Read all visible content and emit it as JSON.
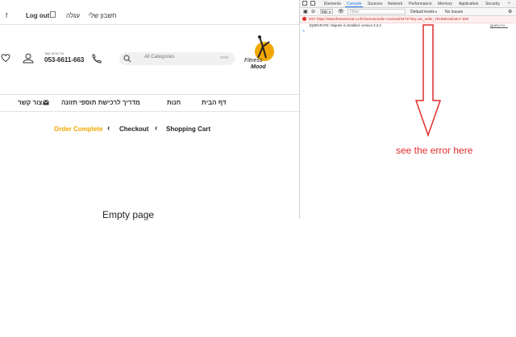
{
  "site": {
    "topbar": {
      "fb": "f",
      "logout": "Log out",
      "cart": "עגלה",
      "account": "חשבון שלי"
    },
    "header": {
      "phone_caption": "צרו איתנו קשר",
      "phone": "053-6611-663",
      "search_placeholder": "All Categories",
      "search_hint": "אחת",
      "logo_text_1": "Fitness",
      "logo_text_2": "Mood"
    },
    "nav": {
      "contact": "צור קשר",
      "guide": "מדריך לרכישת תוספי תזונה",
      "shop": "חנות",
      "home": "דף הבית"
    },
    "breadcrumb": {
      "step1": "Shopping Cart",
      "step2": "Checkout",
      "step3": "Order Complete"
    }
  },
  "devtools": {
    "tabs": [
      "Elements",
      "Console",
      "Sources",
      "Network",
      "Performance",
      "Memory",
      "Application",
      "Security"
    ],
    "context": "top",
    "filter_placeholder": "Filter",
    "levels": "Default levels",
    "issues": "No Issues",
    "error_line": "GET https://www.fitnessmood.co.il/checkout/order-received/3474/?key=wc_order_YEHKBzcabn6A7 500",
    "info_line": "JQMIGRATE: Migrate is installed, version 3.3.2",
    "source_link": "jquery-mi…",
    "prompt": ">"
  },
  "annotations": {
    "note": "see the error here",
    "empty": "Empty page"
  },
  "colors": {
    "accent_orange": "#f2a700",
    "annotation_red": "#e02b2b",
    "devtools_active": "#1a73e8"
  }
}
